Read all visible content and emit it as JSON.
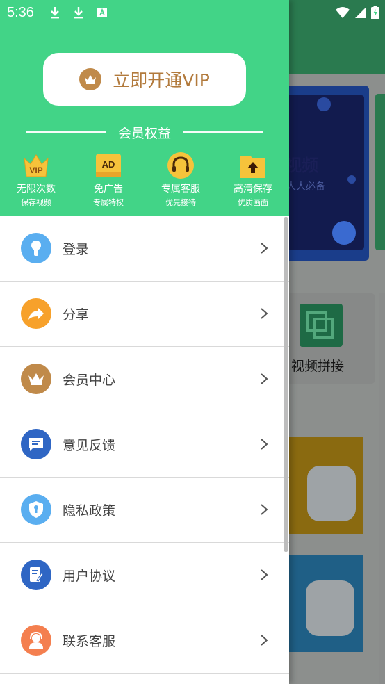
{
  "status_bar": {
    "time": "5:36"
  },
  "background": {
    "banner_title": "视频",
    "banner_subtitle": "人人必备",
    "card_label": "视频拼接"
  },
  "drawer": {
    "vip_button_label": "立即开通VIP",
    "benefits_title": "会员权益",
    "benefits": [
      {
        "title": "无限次数",
        "subtitle": "保存视频",
        "icon": "vip-crown-icon"
      },
      {
        "title": "免广告",
        "subtitle": "专属特权",
        "icon": "ad-icon"
      },
      {
        "title": "专属客服",
        "subtitle": "优先接待",
        "icon": "headset-icon"
      },
      {
        "title": "高清保存",
        "subtitle": "优质画面",
        "icon": "folder-upload-icon"
      }
    ],
    "menu": [
      {
        "label": "登录",
        "icon": "keyhole-icon",
        "color": "#5aaef0"
      },
      {
        "label": "分享",
        "icon": "share-arrow-icon",
        "color": "#f7a12b"
      },
      {
        "label": "会员中心",
        "icon": "crown-icon",
        "color": "#c08a4a"
      },
      {
        "label": "意见反馈",
        "icon": "chat-bubble-icon",
        "color": "#2f66c4"
      },
      {
        "label": "隐私政策",
        "icon": "shield-icon",
        "color": "#5aaef0"
      },
      {
        "label": "用户协议",
        "icon": "document-icon",
        "color": "#2f66c4"
      },
      {
        "label": "联系客服",
        "icon": "support-agent-icon",
        "color": "#f47f4f"
      }
    ]
  },
  "colors": {
    "drawer_header": "#42d487",
    "vip_text": "#b27a3c"
  }
}
